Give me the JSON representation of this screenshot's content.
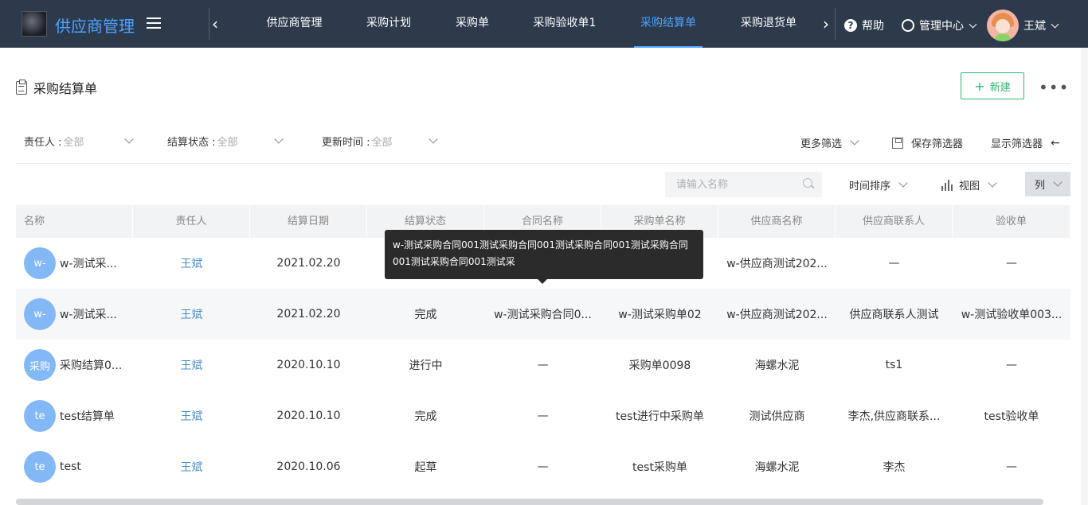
{
  "topbar": {
    "brand": "供应商管理",
    "tabs": [
      "供应商管理",
      "采购计划",
      "采购单",
      "采购验收单1",
      "采购结算单",
      "采购退货单"
    ],
    "active_tab": "采购结算单",
    "help": "帮助",
    "management": "管理中心",
    "user": "王斌",
    "prev_arrow": "‹",
    "next_arrow": "›"
  },
  "page": {
    "title": "采购结算单",
    "new_label": "新建",
    "more": "•••"
  },
  "filters": {
    "owner_label": "责任人 :",
    "owner_value": "全部",
    "status_label": "结算状态 :",
    "status_value": "全部",
    "updated_label": "更新时间 :",
    "updated_value": "全部",
    "more_filters": "更多筛选",
    "save_filter": "保存筛选器",
    "show_filter": "显示筛选器",
    "arrow": "←"
  },
  "toolbar": {
    "search_placeholder": "请输入名称",
    "sort": "时间排序",
    "view": "视图",
    "columns": "列"
  },
  "table": {
    "headers": [
      "名称",
      "责任人",
      "结算日期",
      "结算状态",
      "合同名称",
      "采购单名称",
      "供应商名称",
      "供应商联系人",
      "验收单"
    ],
    "rows": [
      {
        "badge": "w-",
        "name": "w-测试采...",
        "owner": "王斌",
        "date": "2021.02.20",
        "status": "",
        "contract": "",
        "po": "",
        "supplier": "w-供应商测试202...",
        "contact": "—",
        "receipt": "—"
      },
      {
        "badge": "w-",
        "name": "w-测试采...",
        "owner": "王斌",
        "date": "2021.02.20",
        "status": "完成",
        "contract": "w-测试采购合同0...",
        "po": "w-测试采购单02",
        "supplier": "w-供应商测试202...",
        "contact": "供应商联系人测试",
        "receipt": "w-测试验收单003..."
      },
      {
        "badge": "采购",
        "name": "采购结算0...",
        "owner": "王斌",
        "date": "2020.10.10",
        "status": "进行中",
        "contract": "—",
        "po": "采购单0098",
        "supplier": "海螺水泥",
        "contact": "ts1",
        "receipt": "—"
      },
      {
        "badge": "te",
        "name": "test结算单",
        "owner": "王斌",
        "date": "2020.10.10",
        "status": "完成",
        "contract": "—",
        "po": "test进行中采购单",
        "supplier": "测试供应商",
        "contact": "李杰,供应商联系...",
        "receipt": "test验收单"
      },
      {
        "badge": "te",
        "name": "test",
        "owner": "王斌",
        "date": "2020.10.06",
        "status": "起草",
        "contract": "—",
        "po": "test采购单",
        "supplier": "海螺水泥",
        "contact": "李杰",
        "receipt": "—"
      }
    ]
  },
  "tooltip": {
    "line1": "w-测试采购合同001测试采购合同001测试采购合同001测试采购合同",
    "line2": "001测试采购合同001测试采"
  },
  "colors": {
    "topbar_bg": "#2d3a4b",
    "accent_blue": "#4da3ff",
    "new_green": "#2eb872",
    "badge_blue": "#82b8f5"
  }
}
